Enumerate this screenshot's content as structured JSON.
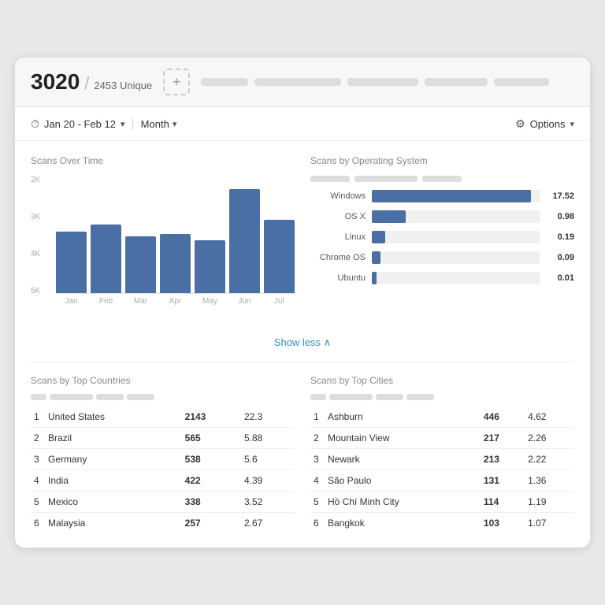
{
  "header": {
    "total": "3020",
    "slash": "/",
    "unique_label": "2453 Unique",
    "add_icon": "+",
    "pills": [
      60,
      110,
      90,
      80,
      70
    ]
  },
  "filter": {
    "date_range": "Jan 20 - Feb 12",
    "granularity": "Month",
    "options_label": "Options"
  },
  "scans_over_time": {
    "title": "Scans Over Time",
    "y_labels": [
      "2K",
      "3K",
      "4K",
      "5K"
    ],
    "bars": [
      {
        "label": "Jan",
        "value": 52
      },
      {
        "label": "Feb",
        "value": 58
      },
      {
        "label": "Mar",
        "value": 48
      },
      {
        "label": "Apr",
        "value": 50
      },
      {
        "label": "May",
        "value": 45
      },
      {
        "label": "Jun",
        "value": 88
      },
      {
        "label": "Jul",
        "value": 62
      }
    ]
  },
  "scans_by_os": {
    "title": "Scans by Operating System",
    "legend_pills": [
      50,
      80,
      50
    ],
    "rows": [
      {
        "label": "Windows",
        "value": 17.52,
        "bar_pct": 95
      },
      {
        "label": "OS X",
        "value": 0.98,
        "bar_pct": 20
      },
      {
        "label": "Linux",
        "value": 0.19,
        "bar_pct": 8
      },
      {
        "label": "Chrome OS",
        "value": 0.09,
        "bar_pct": 5
      },
      {
        "label": "Ubuntu",
        "value": 0.01,
        "bar_pct": 3
      }
    ]
  },
  "show_less_label": "Show less ∧",
  "countries": {
    "title": "Scans by Top Countries",
    "header_pills": [
      20,
      55,
      35,
      35
    ],
    "rows": [
      {
        "rank": 1,
        "name": "United States",
        "count": "2143",
        "pct": "22.3"
      },
      {
        "rank": 2,
        "name": "Brazil",
        "count": "565",
        "pct": "5.88"
      },
      {
        "rank": 3,
        "name": "Germany",
        "count": "538",
        "pct": "5.6"
      },
      {
        "rank": 4,
        "name": "India",
        "count": "422",
        "pct": "4.39"
      },
      {
        "rank": 5,
        "name": "Mexico",
        "count": "338",
        "pct": "3.52"
      },
      {
        "rank": 6,
        "name": "Malaysia",
        "count": "257",
        "pct": "2.67"
      }
    ]
  },
  "cities": {
    "title": "Scans by Top Cities",
    "header_pills": [
      20,
      55,
      35,
      35
    ],
    "rows": [
      {
        "rank": 1,
        "name": "Ashburn",
        "count": "446",
        "pct": "4.62"
      },
      {
        "rank": 2,
        "name": "Mountain View",
        "count": "217",
        "pct": "2.26"
      },
      {
        "rank": 3,
        "name": "Newark",
        "count": "213",
        "pct": "2.22"
      },
      {
        "rank": 4,
        "name": "São Paulo",
        "count": "131",
        "pct": "1.36"
      },
      {
        "rank": 5,
        "name": "Hồ Chí Minh City",
        "count": "114",
        "pct": "1.19"
      },
      {
        "rank": 6,
        "name": "Bangkok",
        "count": "103",
        "pct": "1.07"
      }
    ]
  }
}
